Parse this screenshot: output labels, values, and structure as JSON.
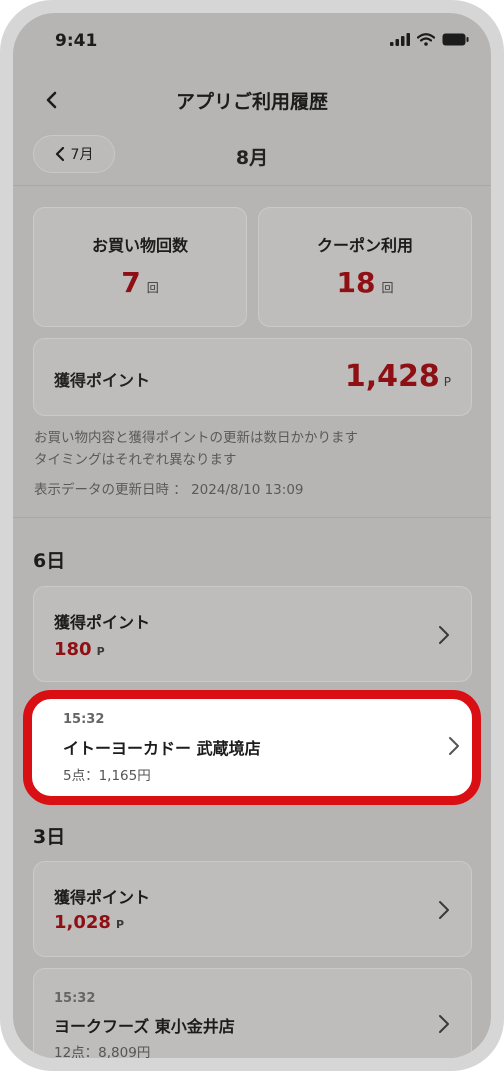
{
  "status_bar": {
    "time": "9:41"
  },
  "header": {
    "title": "アプリご利用履歴"
  },
  "month_nav": {
    "prev_label": "7月",
    "current": "8月"
  },
  "summary": {
    "shopping_count": {
      "label": "お買い物回数",
      "value": "7",
      "unit": "回"
    },
    "coupon_usage": {
      "label": "クーポン利用",
      "value": "18",
      "unit": "回"
    },
    "points": {
      "label": "獲得ポイント",
      "value": "1,428",
      "unit": "P"
    }
  },
  "notes": {
    "line1": "お買い物内容と獲得ポイントの更新は数日かかります",
    "line2": "タイミングはそれぞれ異なります",
    "updated": "表示データの更新日時 ： 2024/8/10 13:09"
  },
  "days": [
    {
      "label": "6日",
      "points_row": {
        "label": "獲得ポイント",
        "value": "180",
        "unit": "P"
      },
      "purchase": {
        "time": "15:32",
        "store": "イトーヨーカドー 武蔵境店",
        "detail": "5点：1,165円"
      }
    },
    {
      "label": "3日",
      "points_row": {
        "label": "獲得ポイント",
        "value": "1,028",
        "unit": "P"
      },
      "purchase": {
        "time": "15:32",
        "store": "ヨークフーズ 東小金井店",
        "detail": "12点：8,809円"
      }
    }
  ],
  "colors": {
    "accent": "#8e0f14",
    "highlight": "#d90f14",
    "overlay": "#b6b5b3"
  },
  "icons": [
    "back-chevron-icon",
    "chevron-left-icon",
    "chevron-right-icon",
    "signal-icon",
    "wifi-icon",
    "battery-icon"
  ]
}
